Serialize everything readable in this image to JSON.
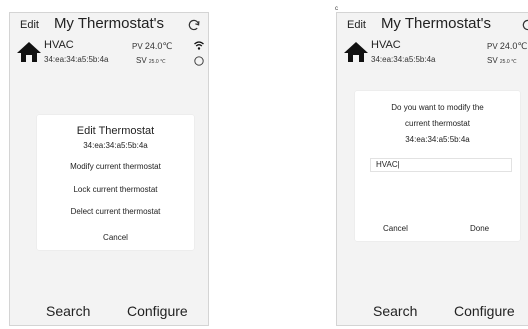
{
  "left": {
    "nav": {
      "edit": "Edit",
      "title": "My Thermostat's"
    },
    "device": {
      "name": "HVAC",
      "mac": "34:ea:34:a5:5b:4a",
      "pv_label": "PV",
      "pv_value": "24.0℃",
      "sv_label": "SV",
      "sv_value": "25.0 ℃"
    },
    "modal": {
      "title": "Edit Thermostat",
      "subtitle": "34:ea:34:a5:5b:4a",
      "options": [
        "Modify current thermostat",
        "Lock current thermostat",
        "Delect current thermostat",
        "Cancel"
      ]
    },
    "bottom": {
      "search": "Search",
      "configure": "Configure"
    }
  },
  "right": {
    "corner_mark": "c",
    "nav": {
      "edit": "Edit",
      "title": "My Thermostat's"
    },
    "device": {
      "name": "HVAC",
      "mac": "34:ea:34:a5:5b:4a",
      "pv_label": "PV",
      "pv_value": "24.0℃",
      "sv_label": "SV",
      "sv_value": "25.0 ℃"
    },
    "modal": {
      "question": [
        "Do you want to modify the",
        "current thermostat",
        "34:ea:34:a5:5b:4a"
      ],
      "input_value": "HVAC|",
      "cancel": "Cancel",
      "done": "Done"
    },
    "bottom": {
      "search": "Search",
      "configure": "Configure"
    }
  },
  "icons": {
    "refresh": "refresh-icon",
    "home": "home-icon",
    "wifi": "wifi-icon",
    "power": "power-icon"
  }
}
